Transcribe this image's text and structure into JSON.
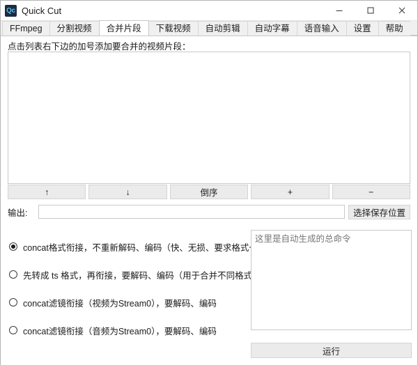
{
  "window": {
    "title": "Quick Cut",
    "icon_label": "Qc",
    "icon_name": "app-icon-quickcut",
    "controls": {
      "minimize": "–",
      "maximize": "□",
      "close": "✕"
    }
  },
  "tabs": [
    {
      "label": "FFmpeg",
      "active": false
    },
    {
      "label": "分割视频",
      "active": false
    },
    {
      "label": "合并片段",
      "active": true
    },
    {
      "label": "下载视频",
      "active": false
    },
    {
      "label": "自动剪辑",
      "active": false
    },
    {
      "label": "自动字幕",
      "active": false
    },
    {
      "label": "语音输入",
      "active": false
    },
    {
      "label": "设置",
      "active": false
    },
    {
      "label": "帮助",
      "active": false
    }
  ],
  "main": {
    "hint": "点击列表右下边的加号添加要合并的视频片段：",
    "clip_list": {
      "items": [],
      "empty": true
    },
    "list_buttons": [
      {
        "label": "↑",
        "name": "move-up-button"
      },
      {
        "label": "↓",
        "name": "move-down-button"
      },
      {
        "label": "倒序",
        "name": "reverse-order-button"
      },
      {
        "label": "+",
        "name": "add-clip-button"
      },
      {
        "label": "−",
        "name": "remove-clip-button"
      }
    ],
    "output": {
      "label": "输出:",
      "value": "",
      "placeholder": "",
      "browse_label": "选择保存位置"
    },
    "merge_modes": [
      {
        "label": "concat格式衔接，不重新解码、编码（快、无损、要求格式一致）",
        "selected": true
      },
      {
        "label": "先转成 ts 格式，再衔接，要解码、编码（用于合并不同格式）",
        "selected": false
      },
      {
        "label": "concat滤镜衔接（视频为Stream0），要解码、编码",
        "selected": false
      },
      {
        "label": "concat滤镜衔接（音频为Stream0），要解码、编码",
        "selected": false
      }
    ],
    "command": {
      "value": "",
      "placeholder": "这里是自动生成的总命令"
    },
    "run_label": "运行"
  },
  "colors": {
    "window_bg": "#ffffff",
    "tabbar_bg": "#f0f0f0",
    "button_bg": "#ebebeb",
    "border": "#c9c9c9",
    "icon_bg": "#1c2b44",
    "icon_fg": "#4fc3e8",
    "placeholder": "#bdbdbd"
  }
}
